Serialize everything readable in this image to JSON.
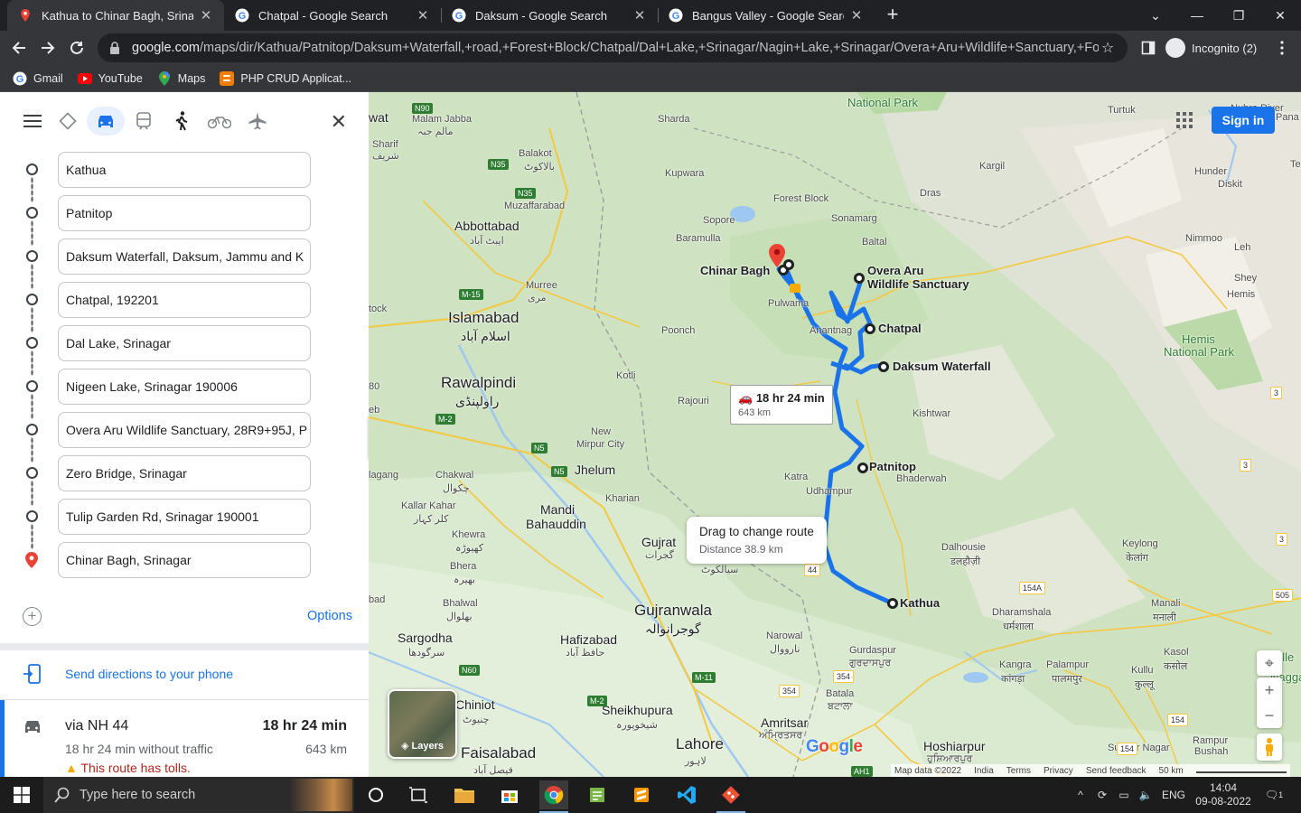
{
  "browser": {
    "tabs": [
      {
        "title": "Kathua to Chinar Bagh, Srinagar",
        "icon": "maps-pin-icon",
        "active": true
      },
      {
        "title": "Chatpal - Google Search",
        "icon": "google-icon",
        "active": false
      },
      {
        "title": "Daksum - Google Search",
        "icon": "google-icon",
        "active": false
      },
      {
        "title": "Bangus Valley - Google Search",
        "icon": "google-icon",
        "active": false
      }
    ],
    "url_host": "google.com",
    "url_path": "/maps/dir/Kathua/Patnitop/Daksum+Waterfall,+road,+Forest+Block/Chatpal/Dal+Lake,+Srinagar/Nagin+Lake,+Srinagar/Overa+Aru+Wildlife+Sanctuary,+Fore...",
    "profile": "Incognito (2)",
    "bookmarks": [
      {
        "label": "Gmail",
        "icon": "google-icon"
      },
      {
        "label": "YouTube",
        "icon": "youtube-icon"
      },
      {
        "label": "Maps",
        "icon": "maps-pin-icon"
      },
      {
        "label": "PHP CRUD Applicat...",
        "icon": "blogger-icon"
      }
    ]
  },
  "directions": {
    "stops": [
      "Kathua",
      "Patnitop",
      "Daksum Waterfall, Daksum, Jammu and K",
      "Chatpal, 192201",
      "Dal Lake, Srinagar",
      "Nigeen Lake, Srinagar 190006",
      "Overa Aru Wildlife Sanctuary, 28R9+95J, P",
      "Zero Bridge, Srinagar",
      "Tulip Garden Rd, Srinagar 190001",
      "Chinar Bagh, Srinagar"
    ],
    "options_label": "Options",
    "send_label": "Send directions to your phone",
    "route": {
      "via": "via NH 44",
      "time": "18 hr 24 min",
      "note": "18 hr 24 min without traffic",
      "distance": "643 km",
      "tolls": "This route has tolls."
    }
  },
  "map": {
    "route_pill": {
      "time": "18 hr 24 min",
      "distance": "643 km"
    },
    "drag_tip": {
      "title": "Drag to change route",
      "distance": "Distance 38.9 km"
    },
    "sign_in": "Sign in",
    "layers_label": "Layers",
    "google": "Google",
    "attribution": [
      "Map data ©2022",
      "India",
      "Terms",
      "Privacy",
      "Send feedback",
      "50 km"
    ],
    "stop_labels": {
      "chinar_bagh": "Chinar Bagh",
      "overa_aru_1": "Overa Aru",
      "overa_aru_2": "Wildlife Sanctuary",
      "chatpal": "Chatpal",
      "daksum": "Daksum Waterfall",
      "patnitop": "Patnitop",
      "kathua": "Kathua"
    },
    "places": {
      "islamabad": "Islamabad",
      "islamabad_ur": "اسلام آباد",
      "rawalpindi": "Rawalpindi",
      "rawalpindi_ur": "راولپنڈی",
      "abbottabad": "Abbottabad",
      "abbottabad_ur": "ایبٹ آباد",
      "gujranwala": "Gujranwala",
      "gujranwala_ur": "گوجرانوالہ",
      "lahore": "Lahore",
      "lahore_ur": "لاہور",
      "faisalabad": "Faisalabad",
      "faisalabad_ur": "فیصل آباد",
      "jhelum": "Jhelum",
      "gujrat": "Gujrat",
      "gujrat_ur": "گجرات",
      "mandi": "Mandi",
      "bahauddin": "Bahauddin",
      "sialkot_ur": "سیالکوٹ",
      "sheikhupura": "Sheikhupura",
      "sheikhupura_ur": "شیخوپورہ",
      "hafizabad": "Hafizabad",
      "hafizabad_ur": "حافظ آباد",
      "sargodha": "Sargodha",
      "sargodha_ur": "سرگودھا",
      "chiniot": "Chiniot",
      "chiniot_ur": "چنیوٹ",
      "amritsar": "Amritsar",
      "amritsar_pa": "ਅੰਮ੍ਰਿਤਸਰ",
      "hoshiarpur": "Hoshiarpur",
      "hoshiarpur_pa": "ਹੁਸ਼ਿਆਰਪੁਰ",
      "dharamshala": "Dharamshala",
      "dharamshala_hi": "धर्मशाला",
      "kangra": "Kangra",
      "kangra_hi": "कांगड़ा",
      "palampur": "Palampur",
      "palampur_hi": "पालमपुर",
      "kullu": "Kullu",
      "kullu_hi": "कुल्लू",
      "manali": "Manali",
      "manali_hi": "मनाली",
      "keylong": "Keylong",
      "keylong_hi": "केलांग",
      "dalhousie": "Dalhousie",
      "dalhousie_hi": "डलहौज़ी",
      "gurdaspur": "Gurdaspur",
      "gurdaspur_pa": "ਗੁਰਦਾਸਪੁਰ",
      "batala": "Batala",
      "batala_pa": "ਬਟਾਲਾ",
      "narowal": "Narowal",
      "narowal_ur": "نارووال",
      "udhampur": "Udhampur",
      "katra": "Katra",
      "bhaderwah": "Bhaderwah",
      "kishtwar": "Kishtwar",
      "rajouri": "Rajouri",
      "kotli": "Kotli",
      "poonch": "Poonch",
      "new_mirpur_1": "New",
      "new_mirpur_2": "Mirpur City",
      "kharian": "Kharian",
      "chakwal": "Chakwal",
      "chakwal_ur": "چکوال",
      "kallar_kahar": "Kallar Kahar",
      "kallar_kahar_ur": "کلر کہار",
      "khewra": "Khewra",
      "khewra_ur": "کھیوڑہ",
      "bhera": "Bhera",
      "bhera_ur": "بھیرہ",
      "bhalwal": "Bhalwal",
      "bhalwal_ur": "بھلوال",
      "murree": "Murree",
      "murree_ur": "مری",
      "muzaffarabad": "Muzaffarabad",
      "balakot": "Balakot",
      "balakot_ur": "بالاکوٹ",
      "kupwara": "Kupwara",
      "sharda": "Sharda",
      "baramulla": "Baramulla",
      "sopore": "Sopore",
      "forest_block": "Forest Block",
      "sonamarg": "Sonamarg",
      "baltal": "Baltal",
      "dras": "Dras",
      "kargil": "Kargil",
      "turtuk": "Turtuk",
      "hunder": "Hunder",
      "diskit": "Diskit",
      "nimmoo": "Nimmoo",
      "leh": "Leh",
      "shey": "Shey",
      "hemis": "Hemis",
      "hemis_np_1": "Hemis",
      "hemis_np_2": "National Park",
      "national_park": "National Park",
      "pulwama": "Pulwama",
      "anantnag": "Anantnag",
      "malam_jabba": "Malam Jabba",
      "malam_jabba_ur": "مالم جبہ",
      "shangla": "Shangla",
      "shangla_sharif": "Sharif",
      "shangla_ur": "شریف",
      "wat": "wat",
      "tock": "tock",
      "lagang": "lagang",
      "ebad": "ebad",
      "bad": "bad",
      "eb": "eb",
      "n80": "80",
      "naggar": "Na",
      "naggar2": "Naggar",
      "rampur_1": "Rampur",
      "rampur_2": "Bushah",
      "sundar_nagar": "Sundar Nagar",
      "kasol": "Kasol",
      "kasol_hi": "कसोल",
      "pana": "Pana",
      "te": "Te",
      "nub_river": "Nubra River",
      "kailash": "alle",
      "pamba": "Pa"
    },
    "shields": [
      "N90",
      "N35",
      "N35",
      "M-15",
      "M-2",
      "N5",
      "N5",
      "44",
      "N60",
      "M-11",
      "M-2",
      "354",
      "354",
      "154",
      "154A",
      "154",
      "154",
      "505",
      "3",
      "3",
      "3",
      "AH1"
    ]
  },
  "taskbar": {
    "search_placeholder": "Type here to search",
    "lang": "ENG",
    "time": "14:04",
    "date": "09-08-2022",
    "notif_count": "1"
  }
}
